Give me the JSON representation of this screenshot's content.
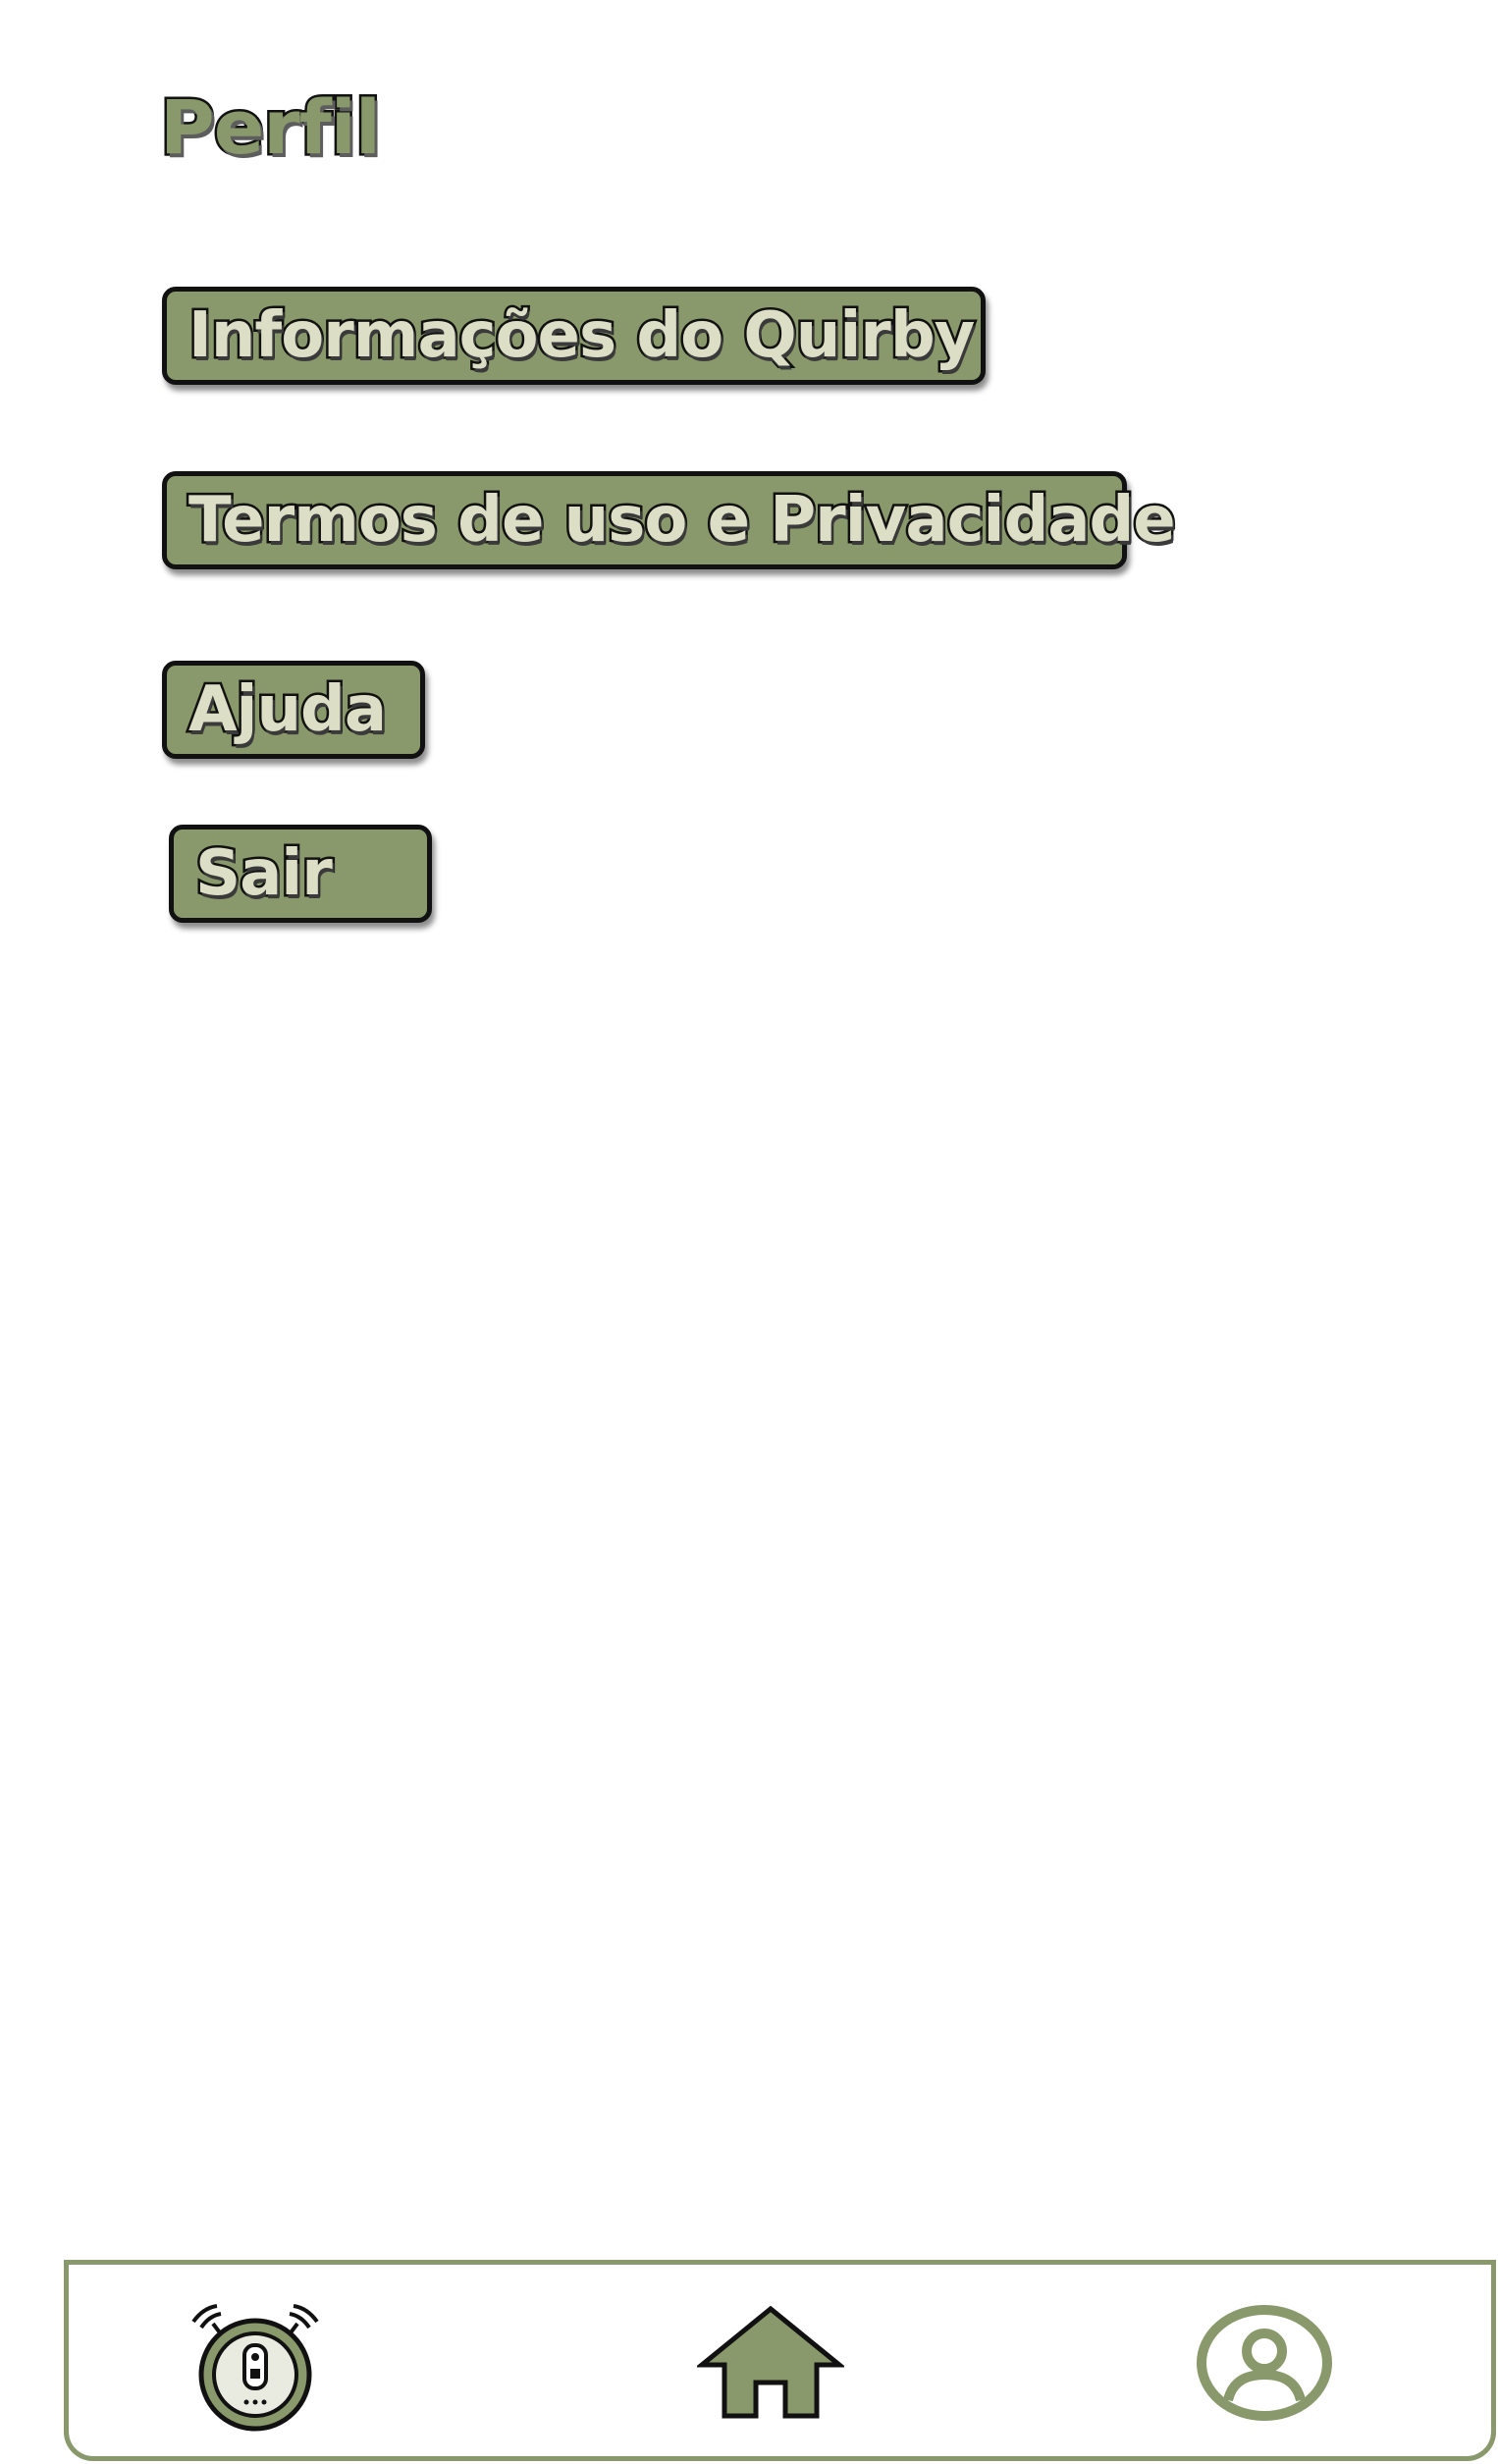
{
  "page": {
    "title": "Perfil"
  },
  "menu": {
    "items": [
      {
        "label": "Informações do Quirby"
      },
      {
        "label": "Termos de uso e Privacidade"
      },
      {
        "label": "Ajuda"
      },
      {
        "label": "Sair"
      }
    ]
  },
  "bottom_nav": {
    "items": [
      {
        "icon": "robot-vacuum-icon"
      },
      {
        "icon": "home-icon"
      },
      {
        "icon": "user-profile-icon"
      }
    ]
  },
  "colors": {
    "accent": "#89996b",
    "button_text": "#dcdfc6",
    "outline": "#111111",
    "background": "#ffffff"
  }
}
